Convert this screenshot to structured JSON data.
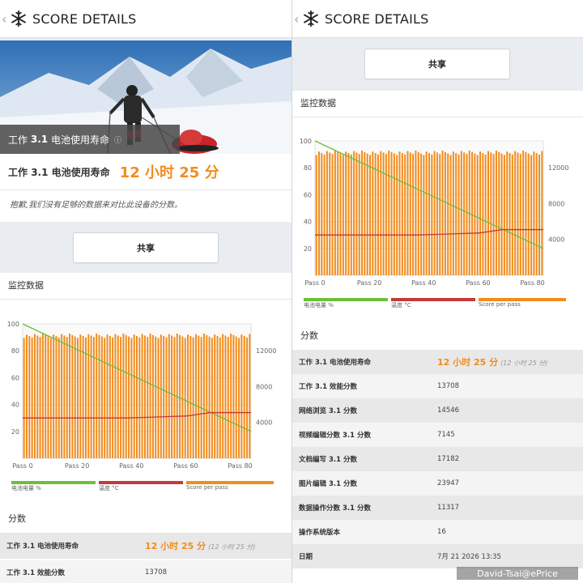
{
  "header": {
    "title": "SCORE DETAILS",
    "back_glyph": "‹",
    "icon": "snowflake-icon"
  },
  "hero": {
    "caption_prefix": "工作",
    "caption_version": "3.1",
    "caption_rest": "电池使用寿命",
    "info_glyph": "ⓘ"
  },
  "result": {
    "label_prefix": "工作",
    "label_version": "3.1",
    "label_rest": "电池使用寿命",
    "value": "12 小时 25 分"
  },
  "note": "抱歉,我们没有足够的数据来对比此设备的分数。",
  "share_label": "共享",
  "monitor_title": "监控数据",
  "scores_title": "分数",
  "chart_data": {
    "type": "bar",
    "x_ticks": [
      "Pass 0",
      "Pass 20",
      "Pass 40",
      "Pass 60",
      "Pass 80"
    ],
    "left_axis": {
      "ticks": [
        "100",
        "80",
        "60",
        "40",
        "20"
      ],
      "range": [
        0,
        100
      ]
    },
    "right_axis": {
      "ticks": [
        "12000",
        "8000",
        "4000"
      ],
      "range": [
        0,
        15000
      ]
    },
    "passes": 85,
    "series": [
      {
        "name": "电池电量 %",
        "color": "#6dbf3b",
        "kind": "line",
        "start": 100,
        "end": 20
      },
      {
        "name": "温度 °C",
        "color": "#c43a3a",
        "kind": "line",
        "start": 30,
        "end": 34
      },
      {
        "name": "Score per pass",
        "color": "#f28c1c",
        "kind": "bar",
        "value": 13700
      }
    ],
    "grid": true
  },
  "scores": [
    {
      "label": "工作 3.1 电池使用寿命",
      "value": "12 小时 25 分",
      "sub": "(12 小时 25 分)",
      "highlight": true
    },
    {
      "label": "工作 3.1 效能分数",
      "value": "13708"
    },
    {
      "label": "网络浏览 3.1 分数",
      "value": "14546"
    },
    {
      "label": "视频编辑分数 3.1 分数",
      "value": "7145"
    },
    {
      "label": "文档编写 3.1 分数",
      "value": "17182"
    },
    {
      "label": "图片编辑 3.1 分数",
      "value": "23947"
    },
    {
      "label": "数据操作分数 3.1 分数",
      "value": "11317"
    },
    {
      "label": "操作系统版本",
      "value": "16"
    },
    {
      "label": "日期",
      "value": "7月 21 2026 13:35"
    }
  ],
  "left_scores_partial": [
    {
      "label": "工作 3.1 电池使用寿命",
      "value": "12 小时 25 分",
      "sub": "(12 小时 25 分)"
    },
    {
      "label": "工作 3.1 效能分数",
      "value": "13708"
    }
  ],
  "watermark": "David-Tsai@ePrice"
}
